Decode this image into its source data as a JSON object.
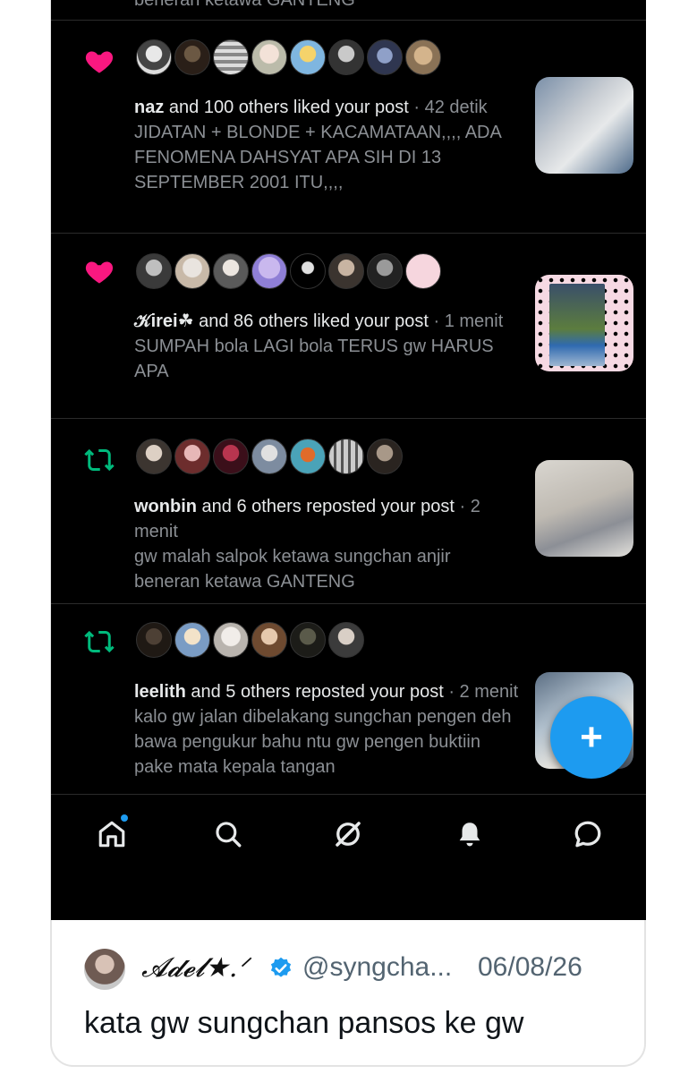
{
  "notifications": [
    {
      "kind": "like",
      "kind_icon": "heart-icon",
      "name": "naz",
      "action_text": " and 100 others liked your post",
      "time": " · 42 detik",
      "body": "JIDATAN + BLONDE + KACAMATAAN,,,, ADA FENOMENA DAHSYAT APA SIH DI 13 SEPTEMBER 2001 ITU,,,,"
    },
    {
      "kind": "like",
      "kind_icon": "heart-icon",
      "name": "𝒦irei☘",
      "action_text": " and 86 others liked your post",
      "time": " · 1 menit",
      "body": "SUMPAH bola LAGI bola TERUS gw HARUS APA"
    },
    {
      "kind": "repost",
      "kind_icon": "repost-icon",
      "name": "wonbin",
      "action_text": " and 6 others reposted your post",
      "time": " · 2 menit",
      "body": "gw malah salpok ketawa sungchan anjir beneran ketawa GANTENG"
    },
    {
      "kind": "repost",
      "kind_icon": "repost-icon",
      "name": "leelith",
      "action_text": " and 5 others reposted your post",
      "time": " · 2 menit",
      "body": "kalo gw jalan dibelakang sungchan pengen deh bawa pengukur bahu ntu gw pengen buktiin pake mata kepala tangan"
    }
  ],
  "partial_top_text": "beneran ketawa GANTENG",
  "fab_label": "+",
  "tabs": [
    "home-icon",
    "search-icon",
    "grok-icon",
    "notifications-icon",
    "messages-icon"
  ],
  "colors": {
    "like": "#f91880",
    "repost": "#00ba7c",
    "accent": "#1d9bf0"
  },
  "quote": {
    "author_name": "𝓐𝓭𝓮𝓵★.ᐟ",
    "handle": "@syngcha...",
    "date": "06/08/26",
    "text": "kata gw sungchan pansos ke gw"
  }
}
